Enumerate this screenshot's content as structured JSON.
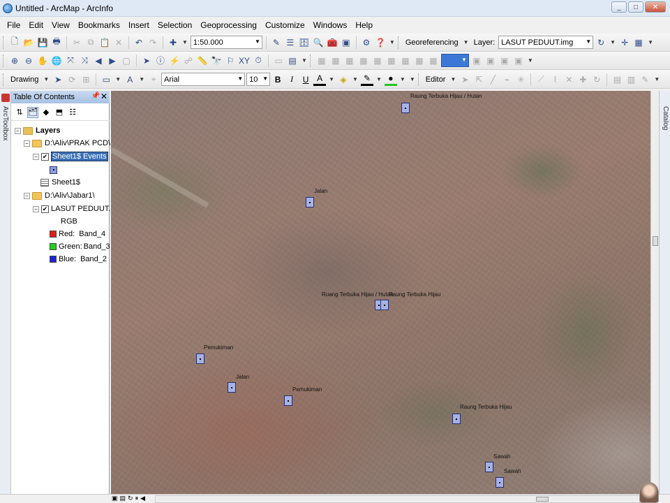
{
  "window": {
    "title": "Untitled - ArcMap - ArcInfo",
    "minimize": "_",
    "maximize": "□",
    "close": "✕"
  },
  "menu": [
    "File",
    "Edit",
    "View",
    "Bookmarks",
    "Insert",
    "Selection",
    "Geoprocessing",
    "Customize",
    "Windows",
    "Help"
  ],
  "toolbar1": {
    "scale": "1:50.000",
    "georef_label": "Georeferencing",
    "layer_label": "Layer:",
    "layer_value": "LASUT PEDUUT.img"
  },
  "toolbar3": {
    "drawing_label": "Drawing",
    "font_name": "Arial",
    "font_size": "10",
    "bold": "B",
    "italic": "I",
    "underline": "U",
    "editor_label": "Editor"
  },
  "toc": {
    "title": "Table Of Contents",
    "side_label": "ArcToolbox",
    "layers_label": "Layers",
    "group1": "D:\\Aliv\\PRAK PCD\\KOOR",
    "events_layer": "Sheet1$ Events",
    "table_layer": "Sheet1$",
    "group2": "D:\\Aliv\\Jabar1\\",
    "raster_layer": "LASUT PEDUUT.img",
    "rgb_label": "RGB",
    "bands": [
      {
        "channel": "Red:",
        "band": "Band_4",
        "color": "#e41a1a"
      },
      {
        "channel": "Green:",
        "band": "Band_3",
        "color": "#1fd11f"
      },
      {
        "channel": "Blue:",
        "band": "Band_2",
        "color": "#1a24d6"
      }
    ]
  },
  "catalog_label": "Catalog",
  "map": {
    "labels": {
      "l1": "Raung Terbuka Hijau / Hutan",
      "l2": "Jalan",
      "l3": "Ruang Terbuka Hijau / Hutan",
      "l4": "Raung Terbuka Hijau",
      "l5": "Pemukiman",
      "l6": "Jalan",
      "l7": "Pemukiman",
      "l8": "Raung Terbuka Hijau",
      "l9": "Sawah",
      "l10": "Sawah"
    }
  }
}
